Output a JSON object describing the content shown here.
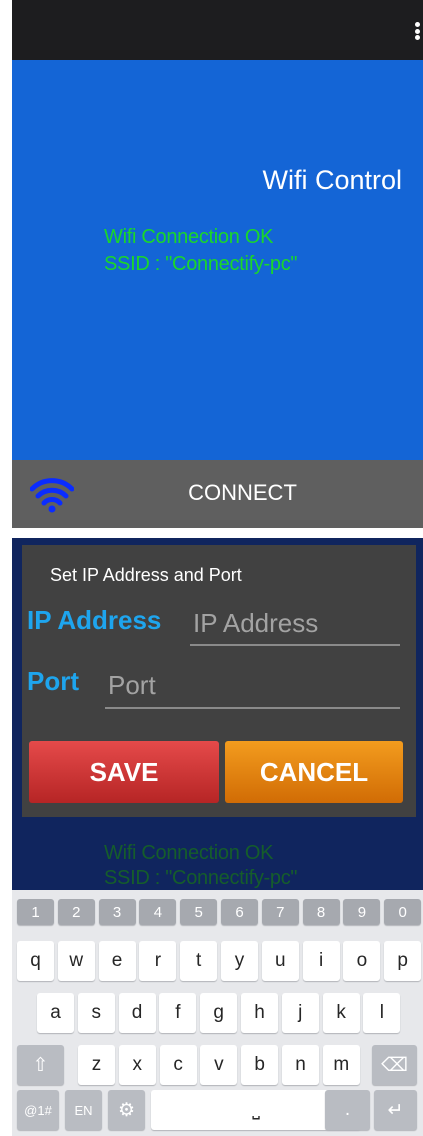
{
  "app": {
    "title": "Wifi Control",
    "connect_label": "CONNECT"
  },
  "status": {
    "line1": "Wifi Connection OK",
    "line2": "SSID : \"Connectify-pc\""
  },
  "icons": {
    "menu": "overflow-menu-icon",
    "wifi": "wifi-icon"
  },
  "colors": {
    "accent": "#1465d6",
    "status_text": "#1ad72a",
    "label": "#1ea5ee",
    "save": "#d33636",
    "cancel": "#ea8610"
  },
  "dialog": {
    "title": "Set IP Address and Port",
    "ip_label": "IP Address",
    "ip_placeholder": "IP Address",
    "ip_value": "",
    "port_label": "Port",
    "port_placeholder": "Port",
    "port_value": "",
    "save_label": "SAVE",
    "cancel_label": "CANCEL"
  },
  "keyboard": {
    "num_row": [
      "1",
      "2",
      "3",
      "4",
      "5",
      "6",
      "7",
      "8",
      "9",
      "0"
    ],
    "row1": [
      "q",
      "w",
      "e",
      "r",
      "t",
      "y",
      "u",
      "i",
      "o",
      "p"
    ],
    "row2": [
      "a",
      "s",
      "d",
      "f",
      "g",
      "h",
      "j",
      "k",
      "l"
    ],
    "row3": [
      "z",
      "x",
      "c",
      "v",
      "b",
      "n",
      "m"
    ],
    "shift": "⇧",
    "backspace": "⌫",
    "sym": "@1#",
    "lang": "EN",
    "settings": "⚙",
    "space": "⎵",
    "period": ".",
    "enter": "↵"
  }
}
